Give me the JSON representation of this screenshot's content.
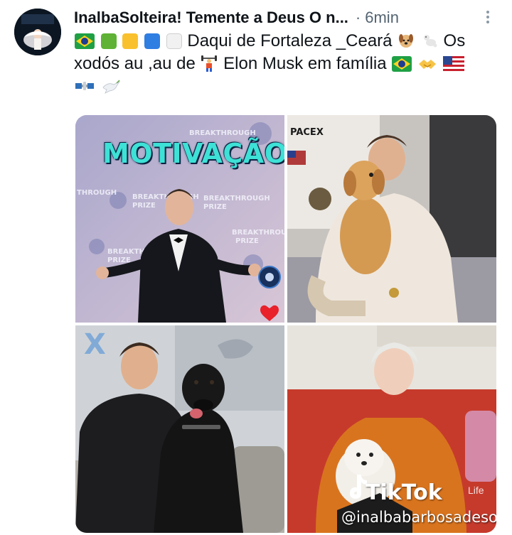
{
  "post": {
    "author_name": "InalbaSolteira! Temente a Deus O n...",
    "separator": "·",
    "time": "6min",
    "text_line1": "Daqui de Fortaleza _Ceará",
    "text_line1_end": "Os",
    "text_line2": "xodós au ,au de",
    "text_line2_mid": "Elon Musk em família"
  },
  "media": {
    "image1_overlay": "MOTIVAÇÃO",
    "image1_backdrop": [
      "BREAKTHROUGH",
      "PRIZE"
    ],
    "image2_logo": "PACEX",
    "image4_brand": "TikTok",
    "image4_brand_suffix": "Life",
    "image4_handle": "@inalbabarbosadeso"
  },
  "icons": {
    "more": "more-vertical-icon",
    "heart": "heart-icon",
    "tiktok": "tiktok-logo-icon"
  },
  "colors": {
    "name": "#0f1419",
    "meta": "#536471",
    "overlay_title": "#3ee1d6",
    "heart": "#e8212b"
  }
}
